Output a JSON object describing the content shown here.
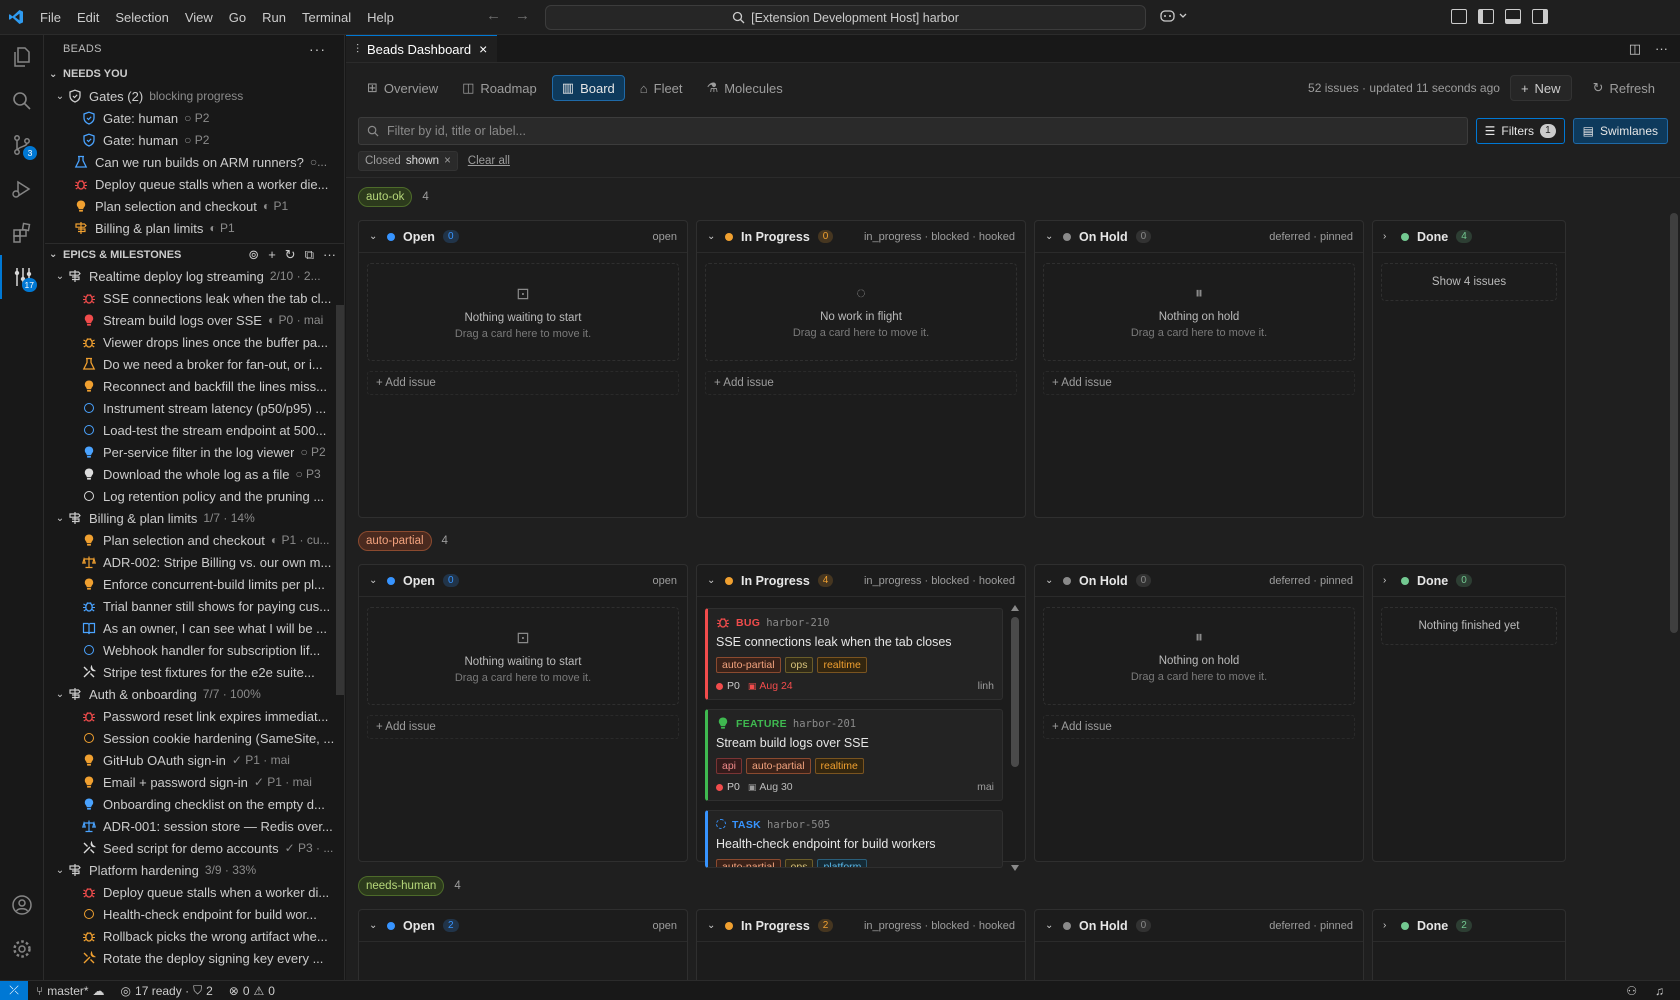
{
  "titlebar": {
    "menus": [
      "File",
      "Edit",
      "Selection",
      "View",
      "Go",
      "Run",
      "Terminal",
      "Help"
    ],
    "command_center": "[Extension Development Host] harbor"
  },
  "activity": {
    "scm_badge": "3",
    "beads_badge": "17"
  },
  "sidebar": {
    "title": "BEADS",
    "needs_you": {
      "label": "NEEDS YOU",
      "gates_label": "Gates (2)",
      "gates_desc": "blocking progress",
      "items": [
        {
          "label": "Gate: human",
          "desc": "○ P2",
          "icon": "shield",
          "color": "#4aa3ff",
          "indent": 2
        },
        {
          "label": "Gate: human",
          "desc": "○ P2",
          "icon": "shield",
          "color": "#4aa3ff",
          "indent": 2
        },
        {
          "label": "Can we run builds on ARM runners?",
          "desc": "○...",
          "icon": "flask",
          "color": "#4aa3ff",
          "indent": 1
        },
        {
          "label": "Deploy queue stalls when a worker die...",
          "desc": "",
          "icon": "bug",
          "color": "#f14c4c",
          "indent": 1
        },
        {
          "label": "Plan selection and checkout",
          "desc": "◐ P1",
          "icon": "bulb",
          "color": "#f0a030",
          "indent": 1
        },
        {
          "label": "Billing & plan limits",
          "desc": "◐ P1",
          "icon": "milestone",
          "color": "#f0a030",
          "indent": 1
        }
      ]
    },
    "epics": {
      "label": "EPICS & MILESTONES",
      "groups": [
        {
          "label": "Realtime deploy log streaming",
          "desc": "2/10 · 2...",
          "items": [
            {
              "label": "SSE connections leak when the tab cl...",
              "desc": "",
              "icon": "bug",
              "color": "#f14c4c"
            },
            {
              "label": "Stream build logs over SSE",
              "desc": "◐ P0 · mai",
              "icon": "bulb",
              "color": "#f14c4c"
            },
            {
              "label": "Viewer drops lines once the buffer pa...",
              "desc": "",
              "icon": "bug",
              "color": "#f0a030"
            },
            {
              "label": "Do we need a broker for fan-out, or i...",
              "desc": "",
              "icon": "flask",
              "color": "#f0a030"
            },
            {
              "label": "Reconnect and backfill the lines miss...",
              "desc": "",
              "icon": "bulb",
              "color": "#f0a030"
            },
            {
              "label": "Instrument stream latency (p50/p95) ...",
              "desc": "",
              "icon": "ring",
              "color": "#4aa3ff"
            },
            {
              "label": "Load-test the stream endpoint at 500...",
              "desc": "",
              "icon": "ring",
              "color": "#4aa3ff"
            },
            {
              "label": "Per-service filter in the log viewer",
              "desc": "○ P2",
              "icon": "bulb",
              "color": "#4aa3ff"
            },
            {
              "label": "Download the whole log as a file",
              "desc": "○ P3",
              "icon": "bulb",
              "color": "#dddddd"
            },
            {
              "label": "Log retention policy and the pruning ...",
              "desc": "",
              "icon": "ring",
              "color": "#dddddd"
            }
          ]
        },
        {
          "label": "Billing & plan limits",
          "desc": "1/7 · 14%",
          "items": [
            {
              "label": "Plan selection and checkout",
              "desc": "◐ P1 · cu...",
              "icon": "bulb",
              "color": "#f0a030"
            },
            {
              "label": "ADR-002: Stripe Billing vs. our own m...",
              "desc": "",
              "icon": "scale",
              "color": "#f0a030"
            },
            {
              "label": "Enforce concurrent-build limits per pl...",
              "desc": "",
              "icon": "bulb",
              "color": "#f0a030"
            },
            {
              "label": "Trial banner still shows for paying cus...",
              "desc": "",
              "icon": "bug",
              "color": "#4aa3ff"
            },
            {
              "label": "As an owner, I can see what I will be ...",
              "desc": "",
              "icon": "book",
              "color": "#4aa3ff"
            },
            {
              "label": "Webhook handler for subscription lif...",
              "desc": "",
              "icon": "ring",
              "color": "#4aa3ff"
            },
            {
              "label": "Stripe test fixtures for the e2e suite...",
              "desc": "",
              "icon": "tools",
              "color": "#dddddd"
            }
          ]
        },
        {
          "label": "Auth & onboarding",
          "desc": "7/7 · 100%",
          "items": [
            {
              "label": "Password reset link expires immediat...",
              "desc": "",
              "icon": "bug",
              "color": "#f14c4c"
            },
            {
              "label": "Session cookie hardening (SameSite, ...",
              "desc": "",
              "icon": "ring",
              "color": "#f0a030"
            },
            {
              "label": "GitHub OAuth sign-in",
              "desc": "✓ P1 · mai",
              "icon": "bulb",
              "color": "#f0a030"
            },
            {
              "label": "Email + password sign-in",
              "desc": "✓ P1 · mai",
              "icon": "bulb",
              "color": "#f0a030"
            },
            {
              "label": "Onboarding checklist on the empty d...",
              "desc": "",
              "icon": "bulb",
              "color": "#4aa3ff"
            },
            {
              "label": "ADR-001: session store — Redis over...",
              "desc": "",
              "icon": "scale",
              "color": "#4aa3ff"
            },
            {
              "label": "Seed script for demo accounts",
              "desc": "✓ P3 · ...",
              "icon": "tools",
              "color": "#dddddd"
            }
          ]
        },
        {
          "label": "Platform hardening",
          "desc": "3/9 · 33%",
          "items": [
            {
              "label": "Deploy queue stalls when a worker di...",
              "desc": "",
              "icon": "bug",
              "color": "#f14c4c"
            },
            {
              "label": "Health-check endpoint for build wor...",
              "desc": "",
              "icon": "ring",
              "color": "#f0a030"
            },
            {
              "label": "Rollback picks the wrong artifact whe...",
              "desc": "",
              "icon": "bug",
              "color": "#f0a030"
            },
            {
              "label": "Rotate the deploy signing key every ...",
              "desc": "",
              "icon": "tools",
              "color": "#f0a030"
            }
          ]
        }
      ]
    }
  },
  "editor": {
    "tab_title": "Beads Dashboard",
    "views": [
      "Overview",
      "Roadmap",
      "Board",
      "Fleet",
      "Molecules"
    ],
    "meta": "52 issues · updated 11 seconds ago",
    "new_label": "New",
    "refresh_label": "Refresh",
    "filter_placeholder": "Filter by id, title or label...",
    "filters_label": "Filters",
    "filters_count": "1",
    "swimlanes_label": "Swimlanes",
    "chip_key": "Closed",
    "chip_value": "shown",
    "clear_all": "Clear all"
  },
  "board": {
    "columns": {
      "open": {
        "name": "Open",
        "states": "open",
        "color": "#3794ff"
      },
      "in_progress": {
        "name": "In Progress",
        "states": "in_progress · blocked · hooked",
        "color": "#f0a030"
      },
      "on_hold": {
        "name": "On Hold",
        "states": "deferred · pinned",
        "color": "#8a8a8a"
      },
      "done": {
        "name": "Done",
        "states": "",
        "color": "#73c991"
      }
    },
    "add_issue": "+ Add issue",
    "drag_hint": "Drag a card here to move it.",
    "empty_open": "Nothing waiting to start",
    "empty_progress": "No work in flight",
    "empty_hold": "Nothing on hold",
    "lanes": [
      {
        "label": "auto-ok",
        "count": "4",
        "open_count": "0",
        "progress_count": "0",
        "hold_count": "0",
        "done_count": "4",
        "done_text": "Show 4 issues"
      },
      {
        "label": "auto-partial",
        "count": "4",
        "open_count": "0",
        "progress_count": "4",
        "hold_count": "0",
        "done_count": "0",
        "done_text": "Nothing finished yet",
        "cards": [
          {
            "type": "BUG",
            "id": "harbor-210",
            "title": "SSE connections leak when the tab closes",
            "labels": [
              "auto-partial",
              "ops",
              "realtime"
            ],
            "priority": "P0",
            "due": "Aug 24",
            "assignee": "linh"
          },
          {
            "type": "FEATURE",
            "id": "harbor-201",
            "title": "Stream build logs over SSE",
            "labels": [
              "api",
              "auto-partial",
              "realtime"
            ],
            "priority": "P0",
            "due": "Aug 30",
            "assignee": "mai"
          },
          {
            "type": "TASK",
            "id": "harbor-505",
            "title": "Health-check endpoint for build workers",
            "labels": [
              "auto-partial",
              "ops",
              "platform"
            ],
            "priority": "",
            "due": "",
            "assignee": ""
          }
        ]
      },
      {
        "label": "needs-human",
        "count": "4",
        "open_count": "2",
        "progress_count": "2",
        "hold_count": "0",
        "done_count": "2"
      }
    ]
  },
  "statusbar": {
    "branch": "master*",
    "ready": "17 ready · ",
    "gates": "2",
    "errors": "0",
    "warnings": "0"
  }
}
